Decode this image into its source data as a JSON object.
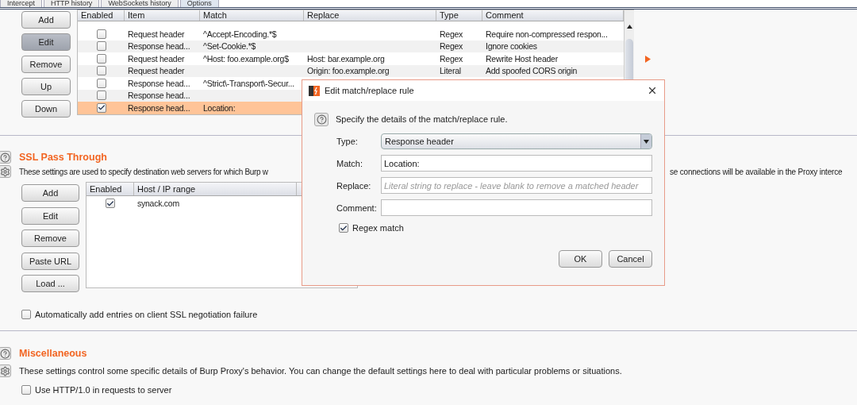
{
  "tabs": [
    {
      "label": "Intercept",
      "selected": false
    },
    {
      "label": "HTTP history",
      "selected": false
    },
    {
      "label": "WebSockets history",
      "selected": false
    },
    {
      "label": "Options",
      "selected": true
    }
  ],
  "match_replace": {
    "buttons": [
      {
        "label": "Add",
        "pressed": false
      },
      {
        "label": "Edit",
        "pressed": true
      },
      {
        "label": "Remove",
        "pressed": false
      },
      {
        "label": "Up",
        "pressed": false
      },
      {
        "label": "Down",
        "pressed": false
      }
    ],
    "columns": [
      "Enabled",
      "Item",
      "Match",
      "Replace",
      "Type",
      "Comment"
    ],
    "rows": [
      {
        "enabled": false,
        "selected": false,
        "item": "Request header",
        "match": "^Accept-Encoding.*$",
        "replace": "",
        "type": "Regex",
        "comment": "Require non-compressed respon..."
      },
      {
        "enabled": false,
        "selected": false,
        "item": "Response head...",
        "match": "^Set-Cookie.*$",
        "replace": "",
        "type": "Regex",
        "comment": "Ignore cookies"
      },
      {
        "enabled": false,
        "selected": false,
        "item": "Request header",
        "match": "^Host: foo.example.org$",
        "replace": "Host: bar.example.org",
        "type": "Regex",
        "comment": "Rewrite Host header"
      },
      {
        "enabled": false,
        "selected": false,
        "item": "Request header",
        "match": "",
        "replace": "Origin: foo.example.org",
        "type": "Literal",
        "comment": "Add spoofed CORS origin"
      },
      {
        "enabled": false,
        "selected": false,
        "item": "Response head...",
        "match": "^Strict\\-Transport\\-Secur..."
      },
      {
        "enabled": false,
        "selected": false,
        "item": "Response head...",
        "match": ""
      },
      {
        "enabled": true,
        "selected": true,
        "item": "Response head...",
        "match": "Location:"
      }
    ]
  },
  "ssl_pass_through": {
    "title": "SSL Pass Through",
    "description_left": "These settings are used to specify destination web servers for which Burp w",
    "description_right": "se connections will be available in the Proxy interce",
    "buttons": [
      "Add",
      "Edit",
      "Remove",
      "Paste URL",
      "Load ..."
    ],
    "columns": [
      "Enabled",
      "Host / IP range"
    ],
    "rows": [
      {
        "enabled": true,
        "host": "synack.com"
      }
    ],
    "auto_add": {
      "label": "Automatically add entries on client SSL negotiation failure",
      "checked": false
    }
  },
  "miscellaneous": {
    "title": "Miscellaneous",
    "description": "These settings control some specific details of Burp Proxy's behavior. You can change the default settings here to deal with particular problems or situations.",
    "options": [
      {
        "label": "Use HTTP/1.0 in requests to server",
        "checked": false
      }
    ]
  },
  "dialog": {
    "title": "Edit match/replace rule",
    "prompt": "Specify the details of the match/replace rule.",
    "type": {
      "label": "Type:",
      "value": "Response header"
    },
    "match": {
      "label": "Match:",
      "value": "Location:"
    },
    "replace": {
      "label": "Replace:",
      "placeholder": "Literal string to replace - leave blank to remove a matched header"
    },
    "comment": {
      "label": "Comment:"
    },
    "regex": {
      "label": "Regex match",
      "checked": true
    },
    "buttons": [
      "OK",
      "Cancel"
    ]
  }
}
